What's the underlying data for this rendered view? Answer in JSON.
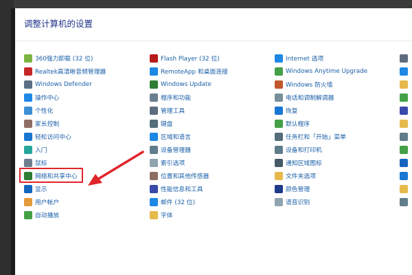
{
  "window": {
    "title": "调整计算机的设置"
  },
  "columns": [
    {
      "items": [
        {
          "label": "360强力卸载 (32 位)",
          "icon": "uninstall-icon",
          "color": "#7cb342"
        },
        {
          "label": "Realtek高清晰音频管理器",
          "icon": "speaker-icon",
          "color": "#c62828"
        },
        {
          "label": "Windows Defender",
          "icon": "defender-wall-icon",
          "color": "#5b6f86"
        },
        {
          "label": "操作中心",
          "icon": "flag-icon",
          "color": "#1e88e5"
        },
        {
          "label": "个性化",
          "icon": "monitor-icon",
          "color": "#3f8fd6"
        },
        {
          "label": "家长控制",
          "icon": "family-icon",
          "color": "#8d6e63"
        },
        {
          "label": "轻松访问中心",
          "icon": "accessibility-icon",
          "color": "#1976d2"
        },
        {
          "label": "入门",
          "icon": "getting-started-icon",
          "color": "#26a69a"
        },
        {
          "label": "鼠标",
          "icon": "mouse-icon",
          "color": "#6d7f8f"
        },
        {
          "label": "网络和共享中心",
          "icon": "network-icon",
          "color": "#2e7d32"
        },
        {
          "label": "显示",
          "icon": "display-icon",
          "color": "#1565c0"
        },
        {
          "label": "用户帐户",
          "icon": "users-icon",
          "color": "#e39b3b"
        },
        {
          "label": "自动播放",
          "icon": "autoplay-icon",
          "color": "#43a047"
        }
      ]
    },
    {
      "items": [
        {
          "label": "Flash Player (32 位)",
          "icon": "flash-icon",
          "color": "#b71c1c"
        },
        {
          "label": "RemoteApp 和桌面连接",
          "icon": "remote-desktop-icon",
          "color": "#1e88e5"
        },
        {
          "label": "Windows Update",
          "icon": "update-icon",
          "color": "#2e7d32"
        },
        {
          "label": "程序和功能",
          "icon": "programs-icon",
          "color": "#6d7f8f"
        },
        {
          "label": "管理工具",
          "icon": "admin-tools-icon",
          "color": "#5d6d7e"
        },
        {
          "label": "键盘",
          "icon": "keyboard-icon",
          "color": "#546e7a"
        },
        {
          "label": "区域和语言",
          "icon": "region-globe-icon",
          "color": "#1e88e5"
        },
        {
          "label": "设备管理器",
          "icon": "device-manager-icon",
          "color": "#607d8b"
        },
        {
          "label": "索引选项",
          "icon": "indexing-icon",
          "color": "#90a4ae"
        },
        {
          "label": "位置和其他传感器",
          "icon": "sensor-icon",
          "color": "#8d6e63"
        },
        {
          "label": "性能信息和工具",
          "icon": "performance-icon",
          "color": "#3949ab"
        },
        {
          "label": "邮件 (32 位)",
          "icon": "mail-icon",
          "color": "#1e88e5"
        },
        {
          "label": "字体",
          "icon": "fonts-folder-icon",
          "color": "#e6b94d"
        }
      ]
    },
    {
      "items": [
        {
          "label": "Internet 选项",
          "icon": "internet-options-icon",
          "color": "#1e88e5"
        },
        {
          "label": "Windows Anytime Upgrade",
          "icon": "windows-logo-icon",
          "color": "#43a047"
        },
        {
          "label": "Windows 防火墙",
          "icon": "firewall-icon",
          "color": "#c0582b"
        },
        {
          "label": "电话和调制解调器",
          "icon": "phone-modem-icon",
          "color": "#78909c"
        },
        {
          "label": "恢复",
          "icon": "recovery-icon",
          "color": "#1976d2"
        },
        {
          "label": "默认程序",
          "icon": "default-programs-icon",
          "color": "#43a047"
        },
        {
          "label": "任务栏和「开始」菜单",
          "icon": "taskbar-icon",
          "color": "#546e7a"
        },
        {
          "label": "设备和打印机",
          "icon": "printer-icon",
          "color": "#607d8b"
        },
        {
          "label": "通知区域图标",
          "icon": "notification-area-icon",
          "color": "#455a64"
        },
        {
          "label": "文件夹选项",
          "icon": "folder-options-icon",
          "color": "#e6b94d"
        },
        {
          "label": "颜色管理",
          "icon": "color-management-icon",
          "color": "#1e3a8a"
        },
        {
          "label": "语音识别",
          "icon": "microphone-icon",
          "color": "#90a4ae"
        }
      ]
    }
  ],
  "partial_column": {
    "icon_colors": [
      "#5d6d7e",
      "#1e88e5",
      "#e6b94d",
      "#43a047",
      "#3949ab",
      "#e6b94d",
      "#607d8b",
      "#43a047",
      "#1565c0",
      "#1976d2",
      "#e6b94d",
      "#607d8b"
    ]
  },
  "annotation": {
    "box_color": "#e0232a",
    "arrow_color": "#e0232a"
  }
}
